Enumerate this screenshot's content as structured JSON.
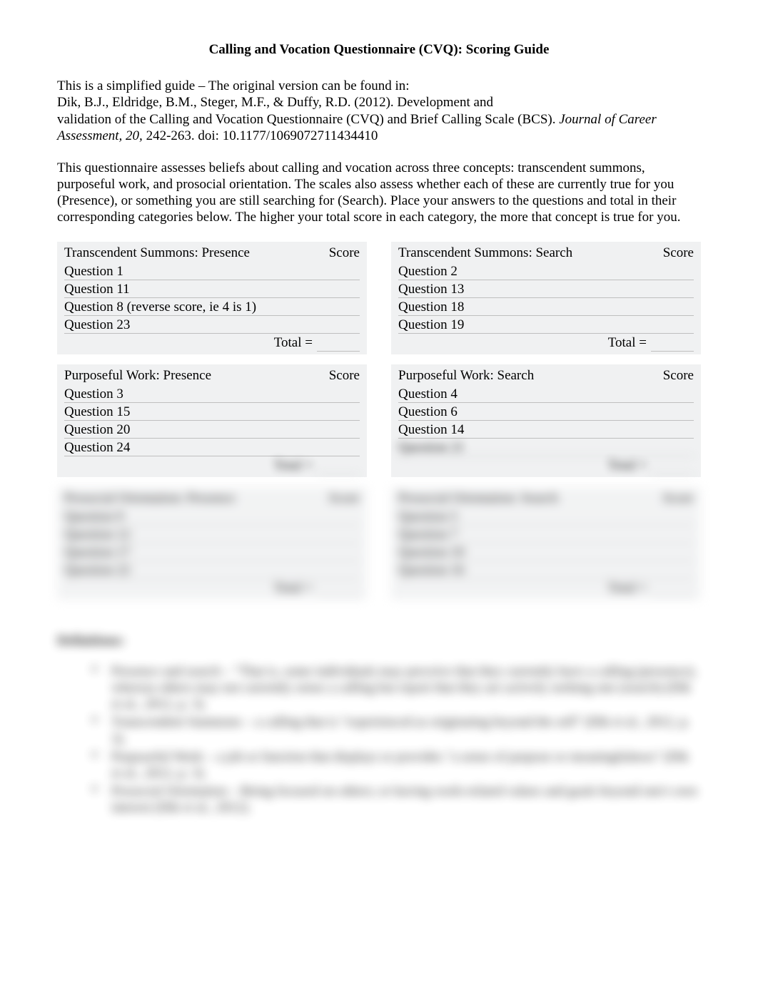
{
  "title": "Calling and Vocation Questionnaire (CVQ): Scoring Guide",
  "intro": {
    "line1": "This is a simplified guide – The original version can be found in:",
    "line2": "Dik, B.J., Eldridge, B.M., Steger, M.F., & Duffy, R.D. (2012). Development and",
    "line3a": "validation of the Calling and Vocation Questionnaire (CVQ) and Brief Calling Scale (BCS). ",
    "line3b": "Journal of Career Assessment, 20,",
    "line3c": " 242-263. doi: 10.1177/1069072711434410"
  },
  "description": "This questionnaire assesses beliefs about calling and vocation across three concepts: transcendent summons, purposeful work, and prosocial orientation. The scales also assess whether each of these are currently true for you (Presence), or something you are still searching for (Search).  Place your answers to the questions and total in their corresponding categories below. The higher your total score in each category, the more that concept is true for you.",
  "score_label": "Score",
  "total_label": "Total =",
  "boxes": [
    {
      "left": {
        "title": "Transcendent Summons: Presence",
        "items": [
          "Question 1",
          "Question 11",
          "Question 8 (reverse score, ie 4 is 1)",
          "Question 23"
        ]
      },
      "right": {
        "title": "Transcendent Summons: Search",
        "items": [
          "Question 2",
          "Question 13",
          "Question 18",
          "Question 19"
        ]
      },
      "blurred": false
    },
    {
      "left": {
        "title": "Purposeful Work: Presence",
        "items": [
          "Question 3",
          "Question 15",
          "Question 20",
          "Question 24"
        ]
      },
      "right": {
        "title": "Purposeful Work: Search",
        "items": [
          "Question 4",
          "Question 6",
          "Question 14",
          "Question 21"
        ]
      },
      "blurred": "partial"
    },
    {
      "left": {
        "title": "Prosocial Orientation: Presence",
        "items": [
          "Question 9",
          "Question 12",
          "Question 17",
          "Question 22"
        ]
      },
      "right": {
        "title": "Prosocial Orientation: Search",
        "items": [
          "Question 5",
          "Question 7",
          "Question 10",
          "Question 16"
        ]
      },
      "blurred": true
    }
  ],
  "definitions_title": "Definitions:",
  "definitions": [
    "Presence and search – \"That is, some individuals may perceive that they currently have a calling (presence), whereas others may not currently sense a calling but report that they are actively seeking one (search) (Dik et al., 2012, p. 3).",
    "Transcendent Summons – a calling that is \"experienced as originating beyond the self\" (Dik et al., 2012, p. 3).",
    "Purposeful Work – a job or function that displays or provides \"a sense of purpose or meaningfulness\" (Dik et al., 2012, p. 3).",
    "Prosocial Orientation – Being focused on others; or having work-related values and goals beyond one's own interest (Dik et al., 2012)."
  ]
}
